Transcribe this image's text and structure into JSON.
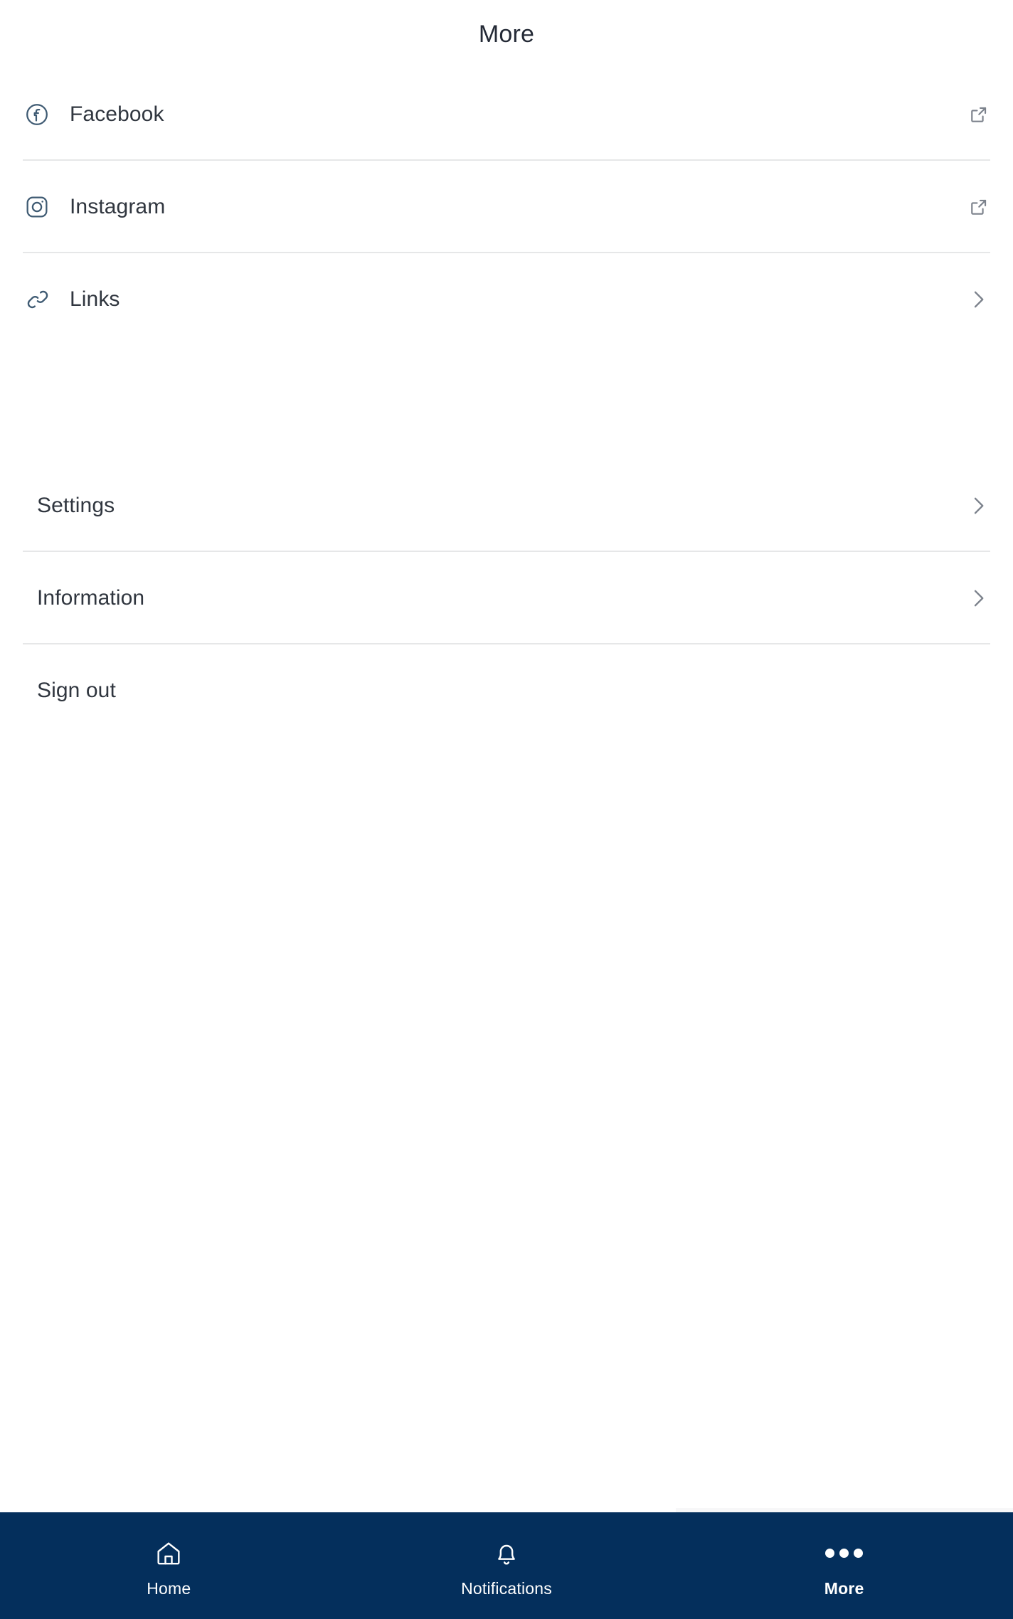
{
  "header": {
    "title": "More"
  },
  "colors": {
    "nav_background": "#042f5c",
    "divider": "#e6e7e8",
    "icon_slate": "#3f5b73",
    "chevron_gray": "#7c828c",
    "text_primary": "#30363f",
    "title": "#242a36"
  },
  "social_group": {
    "items": [
      {
        "label": "Facebook",
        "icon": "facebook-icon",
        "action_icon": "external-link-icon",
        "divider": true
      },
      {
        "label": "Instagram",
        "icon": "instagram-icon",
        "action_icon": "external-link-icon",
        "divider": true
      },
      {
        "label": "Links",
        "icon": "link-chain-icon",
        "action_icon": "chevron-right-icon",
        "divider": false
      }
    ]
  },
  "account_group": {
    "items": [
      {
        "label": "Settings",
        "action_icon": "chevron-right-icon",
        "divider": true
      },
      {
        "label": "Information",
        "action_icon": "chevron-right-icon",
        "divider": true
      },
      {
        "label": "Sign out",
        "action_icon": "none",
        "divider": false
      }
    ]
  },
  "bottom_nav": {
    "items": [
      {
        "label": "Home",
        "icon": "home-icon",
        "active": false
      },
      {
        "label": "Notifications",
        "icon": "bell-icon",
        "active": false
      },
      {
        "label": "More",
        "icon": "ellipsis-icon",
        "active": true
      }
    ]
  }
}
